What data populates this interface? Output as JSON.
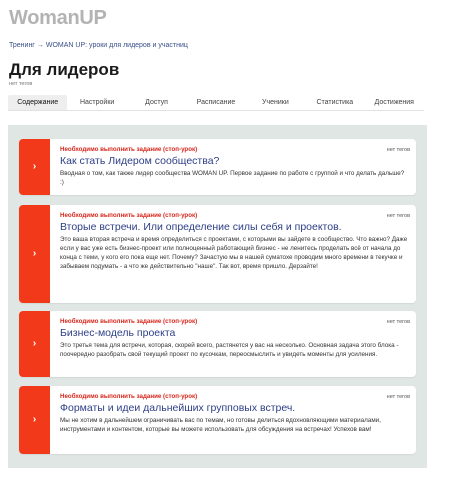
{
  "header": {
    "logo": "WomanUP",
    "breadcrumb_root": "Тренинг",
    "breadcrumb_arrow": "→",
    "breadcrumb_current": "WOMAN UP: уроки для лидеров и участниц",
    "title": "Для лидеров",
    "tags": "нет тегов"
  },
  "tabs": [
    {
      "label": "Содержание",
      "active": true
    },
    {
      "label": "Настройки"
    },
    {
      "label": "Доступ"
    },
    {
      "label": "Расписание"
    },
    {
      "label": "Ученики"
    },
    {
      "label": "Статистика"
    },
    {
      "label": "Достижения"
    }
  ],
  "lessons": [
    {
      "requirement": "Необходимо выполнить задание (стоп-урок)",
      "title": "Как стать Лидером сообщества?",
      "description": "Вводная о том, как также лидер сообщества WOMAN UP. Первое задание по работе с группой и что делать дальше? :)",
      "tags": "нет тегов",
      "icon": "chevron-right-icon"
    },
    {
      "requirement": "Необходимо выполнить задание (стоп-урок)",
      "title": "Вторые встречи. Или определение силы себя и проектов.",
      "description": "Это ваша вторая встреча и время определиться с проектами, с которыми вы зайдете в сообщество. Что важно? Даже если у вас уже есть бизнес-проект или полноценный работающий бизнес - не ленитесь проделать всё от начала до конца с теми, у кого его пока еще нет. Почему? Зачастую мы в нашей суматохе проводим много времени в текучке и забываем подумать - а что же действительно \"наше\". Так вот, время пришло. Дерзайте!",
      "tags": "нет тегов",
      "icon": "chevron-right-icon"
    },
    {
      "requirement": "Необходимо выполнить задание (стоп-урок)",
      "title": "Бизнес-модель проекта",
      "description": "Это третья тема для встречи, которая, скорей всего, растянется у вас на несколько. Основная задача этого блока - поочередно разобрать свой текущий проект по кусочкам, переосмыслить и увидеть моменты для усиления.",
      "tags": "нет тегов",
      "icon": "chevron-right-icon"
    },
    {
      "requirement": "Необходимо выполнить задание (стоп-урок)",
      "title": "Форматы и идеи дальнейших групповых встреч.",
      "description": "Мы не хотим в дальнейшем ограничивать вас по темам, но готовы делиться вдохновляющими материалами, инструментами и контентом, которые вы можете использовать для обсуждения на встречах! Успехов вам!",
      "tags": "нет тегов",
      "icon": "chevron-right-icon"
    }
  ],
  "colors": {
    "accent": "#f2391a",
    "requirement": "#d7261b",
    "link": "#2d3f86",
    "panel": "#dfe6e4"
  }
}
